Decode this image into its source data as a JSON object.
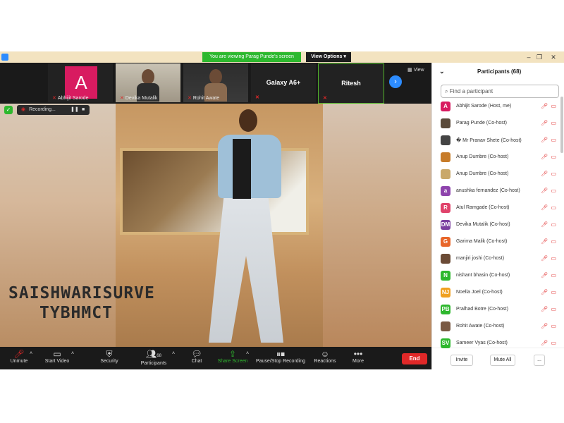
{
  "titlebar": {
    "banner": "You are viewing Parag Punde's screen",
    "view_options": "View Options",
    "controls": [
      "–",
      "❐",
      "✕"
    ]
  },
  "strip": {
    "view_label": "View",
    "tiles": [
      {
        "name": "Abhijit Sarode",
        "initial": "A",
        "color": "#d81b60"
      },
      {
        "name": "Devika Mutalik"
      },
      {
        "name": "Rohit Awate"
      },
      {
        "name": "Galaxy A6+"
      },
      {
        "name": "Ritesh"
      }
    ]
  },
  "video": {
    "recording_label": "Recording...",
    "overlay_line1": "SAISHWARISURVE",
    "overlay_line2": "TYBHMCT"
  },
  "toolbar": {
    "unmute": "Unmute",
    "start_video": "Start Video",
    "security": "Security",
    "participants": "Participants",
    "participants_count": "68",
    "chat": "Chat",
    "share_screen": "Share Screen",
    "pause_stop": "Pause/Stop Recording",
    "reactions": "Reactions",
    "more": "More",
    "end": "End",
    "share_color": "#2eb82e",
    "end_color": "#e02828"
  },
  "panel": {
    "title": "Participants (68)",
    "search_placeholder": "Find a participant",
    "invite": "Invite",
    "mute_all": "Mute All",
    "more": "...",
    "participants": [
      {
        "name": "Abhijit Sarode (Host, me)",
        "avatar": "A",
        "color": "#d81b60"
      },
      {
        "name": "Parag Punde (Co-host)",
        "avatar": "",
        "color": "#5a4a3a"
      },
      {
        "name": "� Mr Pranav Shete (Co-host)",
        "avatar": "",
        "color": "#444444"
      },
      {
        "name": "Anup Dumbre (Co-host)",
        "avatar": "",
        "color": "#c77c2a"
      },
      {
        "name": "Anup Dumbre (Co-host)",
        "avatar": "",
        "color": "#c9a86a"
      },
      {
        "name": "anushka fernandez (Co-host)",
        "avatar": "a",
        "color": "#8e44ad"
      },
      {
        "name": "Atul Ramgade (Co-host)",
        "avatar": "R",
        "color": "#e0436b"
      },
      {
        "name": "Devika Mutalik (Co-host)",
        "avatar": "DM",
        "color": "#7b3fa0"
      },
      {
        "name": "Garima Malik (Co-host)",
        "avatar": "G",
        "color": "#e8662a"
      },
      {
        "name": "manjiri joshi (Co-host)",
        "avatar": "",
        "color": "#6b4b36"
      },
      {
        "name": "nishant bhasin (Co-host)",
        "avatar": "N",
        "color": "#2eb82e"
      },
      {
        "name": "Noella Joel (Co-host)",
        "avatar": "NJ",
        "color": "#f0a020"
      },
      {
        "name": "Pralhad Botre (Co-host)",
        "avatar": "PB",
        "color": "#2eb82e"
      },
      {
        "name": "Rohit Awate (Co-host)",
        "avatar": "",
        "color": "#7a5a44"
      },
      {
        "name": "Sameer Vyas (Co-host)",
        "avatar": "SV",
        "color": "#2eb82e"
      }
    ]
  }
}
